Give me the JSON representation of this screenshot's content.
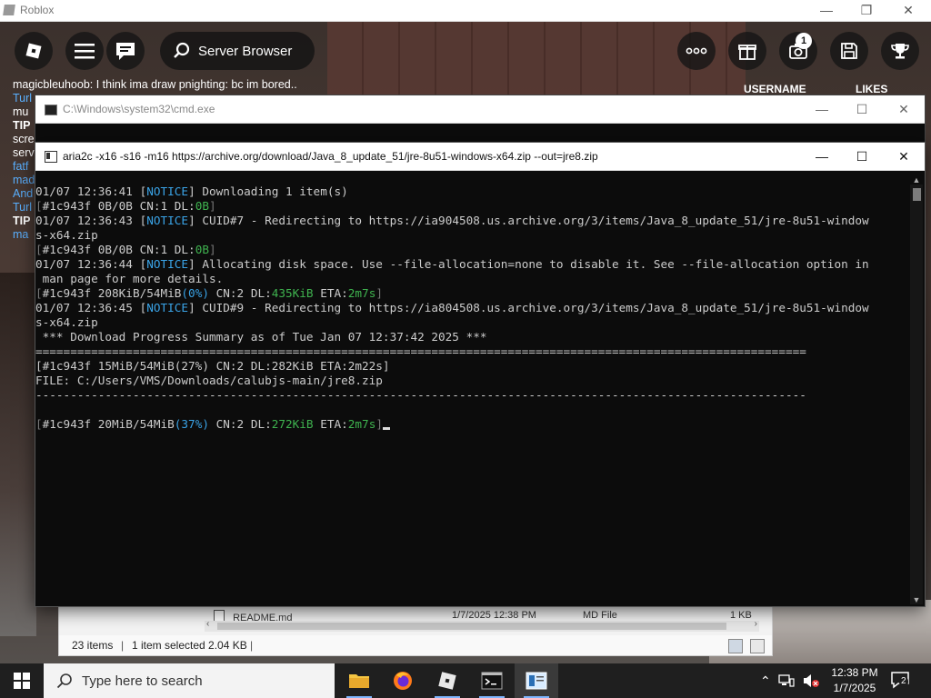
{
  "roblox": {
    "window_title": "Roblox",
    "server_browser_label": "Server Browser",
    "notification_count": "1",
    "username_label": "USERNAME",
    "likes_label": "LIKES",
    "chat_line": "magicbleuhoob: I think ima draw pnighting: bc im bored..",
    "chat_lines": [
      {
        "text": "Turl",
        "kind": "name"
      },
      {
        "text": "mu",
        "kind": "text"
      },
      {
        "text": "TIP",
        "kind": "tip"
      },
      {
        "text": "scre",
        "kind": "text"
      },
      {
        "text": "serv",
        "kind": "text"
      },
      {
        "text": "fatf",
        "kind": "name"
      },
      {
        "text": "mad",
        "kind": "name"
      },
      {
        "text": "And",
        "kind": "name"
      },
      {
        "text": "Turl",
        "kind": "name"
      },
      {
        "text": "TIP",
        "kind": "tip"
      },
      {
        "text": "ma",
        "kind": "name"
      }
    ]
  },
  "cmd_background": {
    "title": "C:\\Windows\\system32\\cmd.exe"
  },
  "terminal": {
    "title": "aria2c -x16 -s16 -m16 https://archive.org/download/Java_8_update_51/jre-8u51-windows-x64.zip --out=jre8.zip",
    "lines": [
      [
        {
          "t": "01/07 12:36:41 ["
        },
        {
          "t": "NOTICE",
          "c": "cy"
        },
        {
          "t": "] Downloading 1 item(s)"
        }
      ],
      [
        {
          "t": "[",
          "c": "gy"
        },
        {
          "t": "#1c943f 0B/0B CN:1 DL:"
        },
        {
          "t": "0B",
          "c": "gr"
        },
        {
          "t": "]",
          "c": "gy"
        }
      ],
      [
        {
          "t": "01/07 12:36:43 ["
        },
        {
          "t": "NOTICE",
          "c": "cy"
        },
        {
          "t": "] CUID#7 - Redirecting to https://ia904508.us.archive.org/3/items/Java_8_update_51/jre-8u51-window"
        }
      ],
      [
        {
          "t": "s-x64.zip"
        }
      ],
      [
        {
          "t": "[",
          "c": "gy"
        },
        {
          "t": "#1c943f 0B/0B CN:1 DL:"
        },
        {
          "t": "0B",
          "c": "gr"
        },
        {
          "t": "]",
          "c": "gy"
        }
      ],
      [
        {
          "t": "01/07 12:36:44 ["
        },
        {
          "t": "NOTICE",
          "c": "cy"
        },
        {
          "t": "] Allocating disk space. Use --file-allocation=none to disable it. See --file-allocation option in"
        }
      ],
      [
        {
          "t": " man page for more details."
        }
      ],
      [
        {
          "t": "[",
          "c": "gy"
        },
        {
          "t": "#1c943f 208KiB/54MiB"
        },
        {
          "t": "(0%)",
          "c": "cy"
        },
        {
          "t": " CN:2 DL:"
        },
        {
          "t": "435KiB",
          "c": "gr"
        },
        {
          "t": " ETA:"
        },
        {
          "t": "2m7s",
          "c": "gr"
        },
        {
          "t": "]",
          "c": "gy"
        }
      ],
      [
        {
          "t": "01/07 12:36:45 ["
        },
        {
          "t": "NOTICE",
          "c": "cy"
        },
        {
          "t": "] CUID#9 - Redirecting to https://ia804508.us.archive.org/3/items/Java_8_update_51/jre-8u51-window"
        }
      ],
      [
        {
          "t": "s-x64.zip"
        }
      ],
      [
        {
          "t": " *** Download Progress Summary as of Tue Jan 07 12:37:42 2025 ***"
        }
      ],
      [
        {
          "t": "==============================================================================================================="
        }
      ],
      [
        {
          "t": "[#1c943f 15MiB/54MiB(27%) CN:2 DL:282KiB ETA:2m22s]"
        }
      ],
      [
        {
          "t": "FILE: C:/Users/VMS/Downloads/calubjs-main/jre8.zip"
        }
      ],
      [
        {
          "t": "---------------------------------------------------------------------------------------------------------------"
        }
      ],
      [],
      [
        {
          "t": "[",
          "c": "gy"
        },
        {
          "t": "#1c943f 20MiB/54MiB"
        },
        {
          "t": "(37%)",
          "c": "cy"
        },
        {
          "t": " CN:2 DL:"
        },
        {
          "t": "272KiB",
          "c": "gr"
        },
        {
          "t": " ETA:"
        },
        {
          "t": "2m7s",
          "c": "gr"
        },
        {
          "t": "]",
          "c": "gy"
        },
        {
          "t": "",
          "cursor": true
        }
      ]
    ]
  },
  "explorer": {
    "file_name": "README.md",
    "file_date": "1/7/2025 12:38 PM",
    "file_type": "MD File",
    "file_size": "1 KB",
    "items_count": "23 items",
    "selection": "1 item selected  2.04 KB"
  },
  "taskbar": {
    "search_placeholder": "Type here to search",
    "time": "12:38 PM",
    "date": "1/7/2025",
    "notification_count": "2"
  }
}
